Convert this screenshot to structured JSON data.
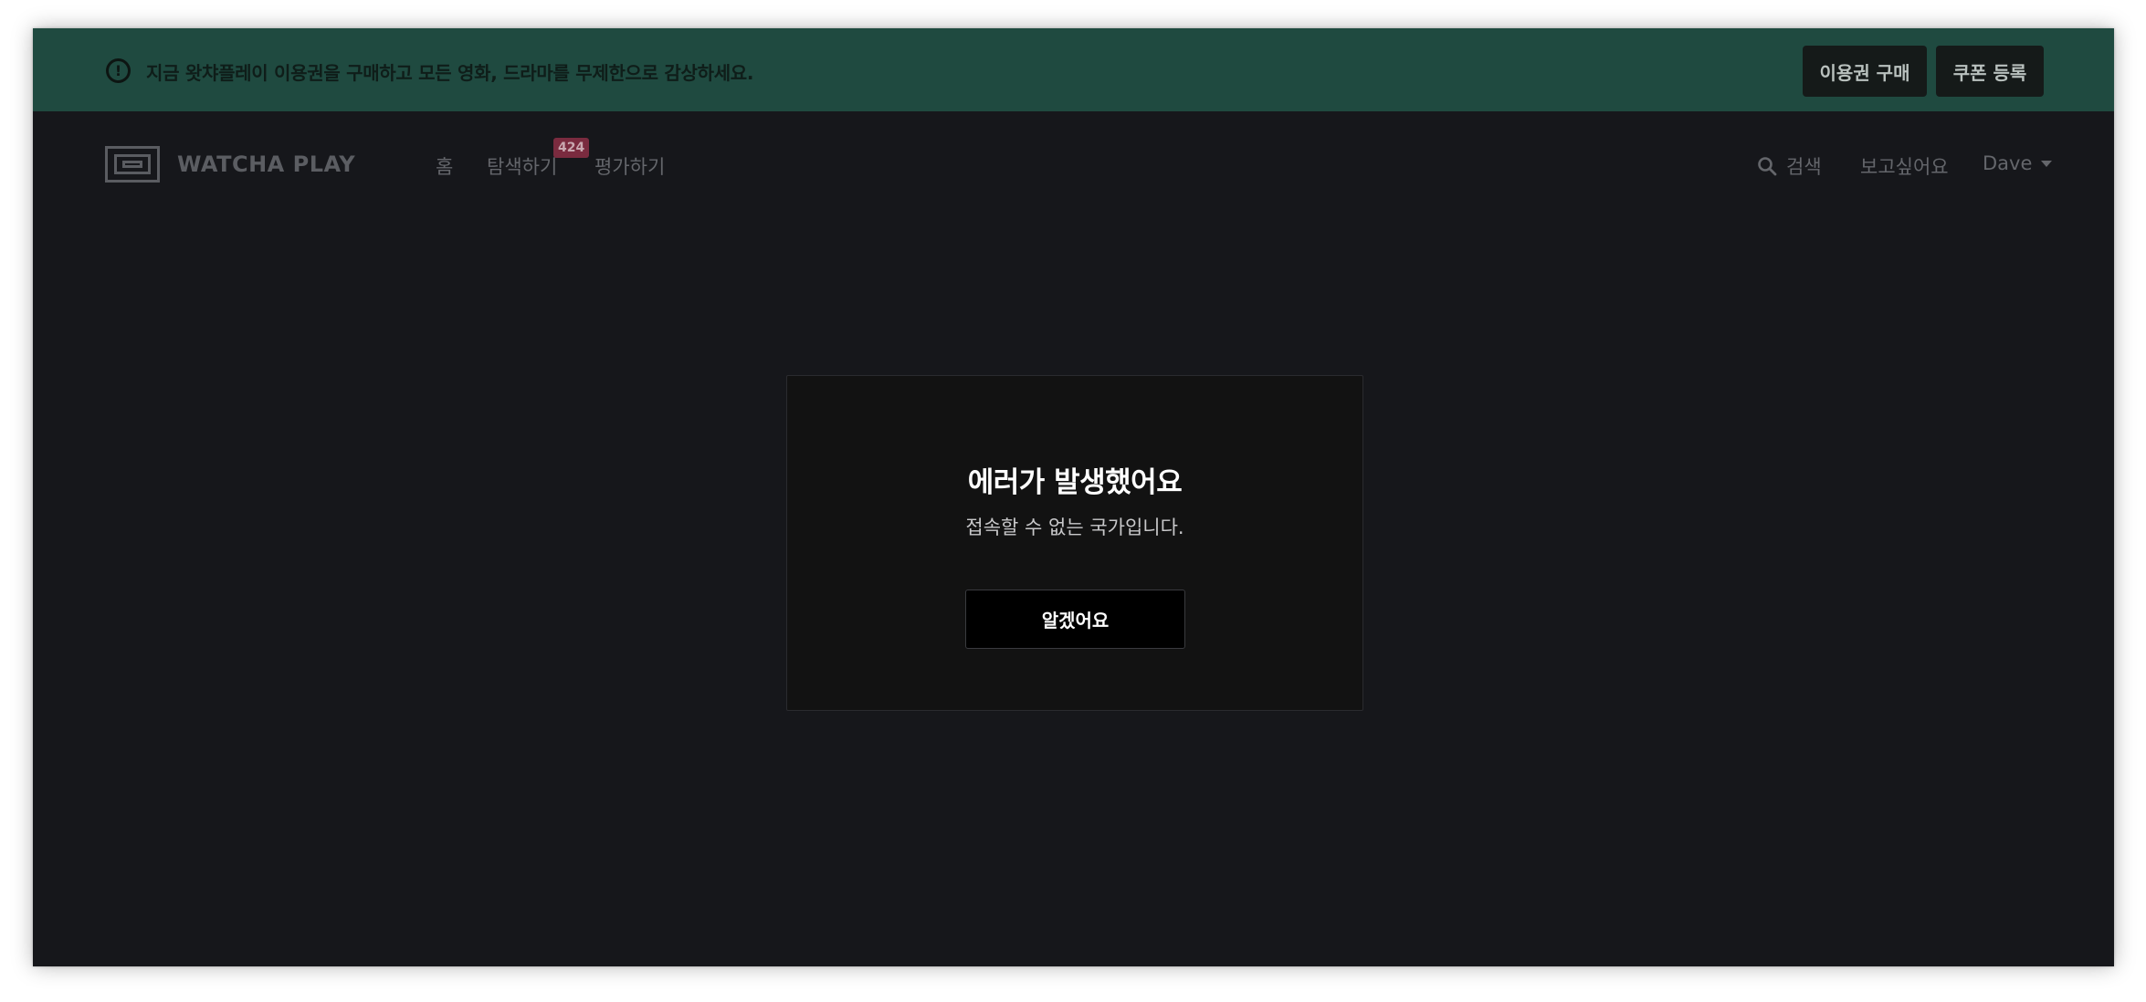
{
  "banner": {
    "message": "지금 왓챠플레이 이용권을 구매하고 모든 영화, 드라마를 무제한으로 감상하세요.",
    "info_icon": "info-circle-icon",
    "buy_label": "이용권 구매",
    "coupon_label": "쿠폰 등록"
  },
  "header": {
    "logo_text": "WATCHA PLAY",
    "nav": {
      "home": "홈",
      "explore": "탐색하기",
      "explore_badge": "424",
      "rate": "평가하기"
    },
    "search_label": "검색",
    "wishlist_label": "보고싶어요",
    "user_name": "Dave"
  },
  "modal": {
    "title": "에러가 발생했어요",
    "message": "접속할 수 없는 국가입니다.",
    "confirm_label": "알겠어요"
  },
  "colors": {
    "banner_bg": "#1f4a40",
    "page_bg": "#16171b",
    "modal_bg": "#121212",
    "badge_bg": "#7a2b3f"
  }
}
